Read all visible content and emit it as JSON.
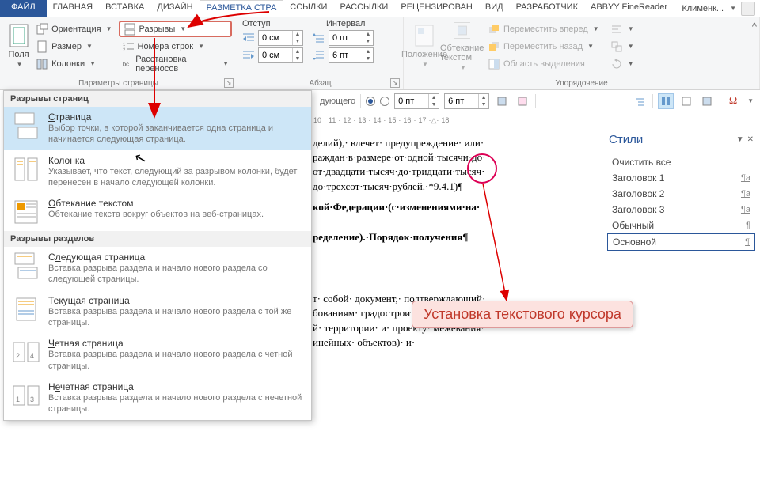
{
  "tabs": {
    "file": "ФАЙЛ",
    "items": [
      "ГЛАВНАЯ",
      "ВСТАВКА",
      "ДИЗАЙН",
      "РАЗМЕТКА СТРА",
      "ССЫЛКИ",
      "РАССЫЛКИ",
      "РЕЦЕНЗИРОВАН",
      "ВИД",
      "РАЗРАБОТЧИК",
      "ABBYY FineReader"
    ],
    "user": "Клименк..."
  },
  "ribbon": {
    "fields_btn": "Поля",
    "orientation": "Ориентация",
    "size": "Размер",
    "columns": "Колонки",
    "breaks": "Разрывы",
    "line_numbers": "Номера строк",
    "hyphenation": "Расстановка переносов",
    "page_setup_group": "Параметры страницы",
    "indent_label": "Отступ",
    "spacing_label": "Интервал",
    "indent_left": "0 см",
    "indent_right": "0 см",
    "spacing_before": "0 пт",
    "spacing_after": "6 пт",
    "paragraph_group": "Абзац",
    "position": "Положение",
    "wrap": "Обтекание текстом",
    "bring_forward": "Переместить вперед",
    "send_backward": "Переместить назад",
    "selection_pane": "Область выделения",
    "arrange_group": "Упорядочение"
  },
  "subbar": {
    "val1": "0 пт",
    "val2": "6 пт"
  },
  "ruler": [
    "10",
    "11",
    "12",
    "13",
    "14",
    "15",
    "16",
    "17",
    "18"
  ],
  "dropdown": {
    "section1": "Разрывы страниц",
    "section2": "Разрывы разделов",
    "items": [
      {
        "title_pre": "",
        "u": "С",
        "title_post": "траница",
        "desc": "Выбор точки, в которой заканчивается одна страница и начинается следующая страница."
      },
      {
        "title_pre": "",
        "u": "К",
        "title_post": "олонка",
        "desc": "Указывает, что текст, следующий за разрывом колонки, будет перенесен в начало следующей колонки."
      },
      {
        "title_pre": "",
        "u": "О",
        "title_post": "бтекание текстом",
        "desc": "Обтекание текста вокруг объектов на веб-страницах."
      },
      {
        "title_pre": "С",
        "u": "л",
        "title_post": "едующая страница",
        "desc": "Вставка разрыва раздела и начало нового раздела со следующей страницы."
      },
      {
        "title_pre": "",
        "u": "Т",
        "title_post": "екущая страница",
        "desc": "Вставка разрыва раздела и начало нового раздела с той же страницы."
      },
      {
        "title_pre": "",
        "u": "Ч",
        "title_post": "етная страница",
        "desc": "Вставка разрыва раздела и начало нового раздела с четной страницы."
      },
      {
        "title_pre": "Н",
        "u": "е",
        "title_post": "четная страница",
        "desc": "Вставка разрыва раздела и начало нового раздела с нечетной страницы."
      }
    ]
  },
  "doc": {
    "p1": "делий),· влечет· предупреждение· или·",
    "p2": "раждан·в·размере·от·одной·тысячи·до·",
    "p3": "от·двадцати·тысяч·до·тридцати·тысяч·",
    "p4": "до·трехсот·тысяч·рублей.·*9.4.1)¶",
    "p5": "кой·Федерации·(с·изменениями·на·",
    "p6": "ределение).·Порядок·получения¶",
    "p7": "т· собой· документ,· подтверждающий·",
    "p8": "бованиям· градостроительного· плана·",
    "p9": "й· территории· и· проекту· межевания·",
    "p10": "инейных· объектов)· и·"
  },
  "styles": {
    "title": "Стили",
    "items": [
      "Очистить все",
      "Заголовок 1",
      "Заголовок 2",
      "Заголовок 3",
      "Обычный",
      "Основной"
    ],
    "marks": [
      "",
      "¶a",
      "¶a",
      "¶a",
      "¶",
      "¶"
    ]
  },
  "callout": "Установка текстового курсора"
}
